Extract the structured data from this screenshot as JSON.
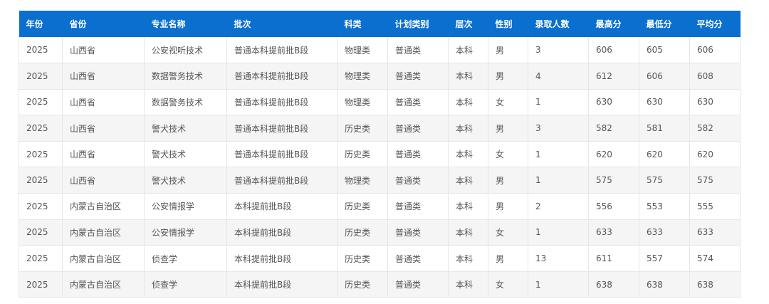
{
  "table": {
    "headers": [
      "年份",
      "省份",
      "专业名称",
      "批次",
      "科类",
      "计划类别",
      "层次",
      "性别",
      "录取人数",
      "最高分",
      "最低分",
      "平均分"
    ],
    "rows": [
      [
        "2025",
        "山西省",
        "公安视听技术",
        "普通本科提前批B段",
        "物理类",
        "普通类",
        "本科",
        "男",
        "3",
        "606",
        "605",
        "606"
      ],
      [
        "2025",
        "山西省",
        "数据警务技术",
        "普通本科提前批B段",
        "物理类",
        "普通类",
        "本科",
        "男",
        "4",
        "612",
        "606",
        "608"
      ],
      [
        "2025",
        "山西省",
        "数据警务技术",
        "普通本科提前批B段",
        "物理类",
        "普通类",
        "本科",
        "女",
        "1",
        "630",
        "630",
        "630"
      ],
      [
        "2025",
        "山西省",
        "警犬技术",
        "普通本科提前批B段",
        "历史类",
        "普通类",
        "本科",
        "男",
        "3",
        "582",
        "581",
        "582"
      ],
      [
        "2025",
        "山西省",
        "警犬技术",
        "普通本科提前批B段",
        "历史类",
        "普通类",
        "本科",
        "女",
        "1",
        "620",
        "620",
        "620"
      ],
      [
        "2025",
        "山西省",
        "警犬技术",
        "普通本科提前批B段",
        "物理类",
        "普通类",
        "本科",
        "男",
        "1",
        "575",
        "575",
        "575"
      ],
      [
        "2025",
        "内蒙古自治区",
        "公安情报学",
        "本科提前批B段",
        "历史类",
        "普通类",
        "本科",
        "男",
        "2",
        "556",
        "553",
        "555"
      ],
      [
        "2025",
        "内蒙古自治区",
        "公安情报学",
        "本科提前批B段",
        "历史类",
        "普通类",
        "本科",
        "女",
        "1",
        "633",
        "633",
        "633"
      ],
      [
        "2025",
        "内蒙古自治区",
        "侦查学",
        "本科提前批B段",
        "历史类",
        "普通类",
        "本科",
        "男",
        "13",
        "611",
        "557",
        "574"
      ],
      [
        "2025",
        "内蒙古自治区",
        "侦查学",
        "本科提前批B段",
        "历史类",
        "普通类",
        "本科",
        "女",
        "1",
        "638",
        "638",
        "638"
      ]
    ]
  },
  "colors": {
    "header_bg": "#0a6fce",
    "header_text": "#ffffff",
    "cell_text": "#555555",
    "row_alt_bg": "#f5f5f5",
    "border": "#e6e6e6"
  }
}
